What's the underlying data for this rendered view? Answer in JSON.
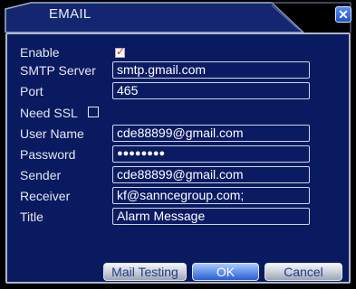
{
  "window": {
    "title": "EMAIL",
    "close_symbol": "✕"
  },
  "form": {
    "enable": {
      "label": "Enable",
      "checked": true
    },
    "smtp_server": {
      "label": "SMTP Server",
      "value": "smtp.gmail.com"
    },
    "port": {
      "label": "Port",
      "value": "465"
    },
    "need_ssl": {
      "label": "Need SSL",
      "checked": false
    },
    "user_name": {
      "label": "User Name",
      "value": "cde88899@gmail.com"
    },
    "password": {
      "label": "Password",
      "value": "●●●●●●●●"
    },
    "sender": {
      "label": "Sender",
      "value": "cde88899@gmail.com"
    },
    "receiver": {
      "label": "Receiver",
      "value": "kf@sanncegroup.com;"
    },
    "title": {
      "label": "Title",
      "value": "Alarm Message"
    }
  },
  "buttons": {
    "mail_testing": "Mail Testing",
    "ok": "OK",
    "cancel": "Cancel"
  },
  "colors": {
    "panel": "#0a1a60",
    "accent": "#2e5bd0",
    "check": "#e0281e"
  }
}
